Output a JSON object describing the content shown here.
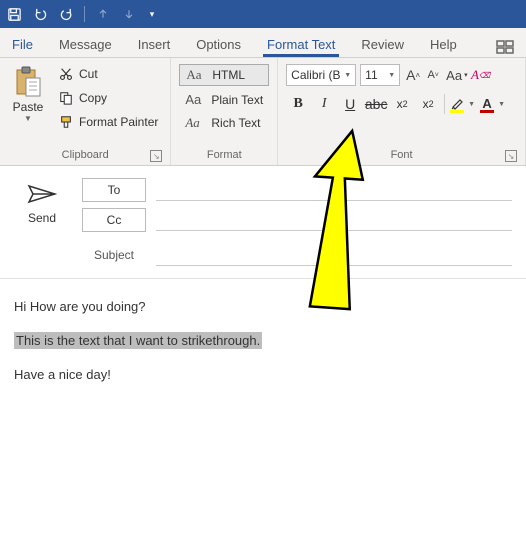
{
  "tabs": {
    "file": "File",
    "message": "Message",
    "insert": "Insert",
    "options": "Options",
    "format_text": "Format Text",
    "review": "Review",
    "help": "Help"
  },
  "clipboard": {
    "paste": "Paste",
    "cut": "Cut",
    "copy": "Copy",
    "format_painter": "Format Painter",
    "group_label": "Clipboard"
  },
  "format_group": {
    "html": "HTML",
    "plain": "Plain Text",
    "rich": "Rich Text",
    "aa": "Aa",
    "group_label": "Format"
  },
  "font": {
    "name": "Calibri (B",
    "size": "11",
    "group_label": "Font",
    "grow": "A",
    "shrink": "A",
    "case": "Aa",
    "bold": "B",
    "italic": "I",
    "underline": "U",
    "strike": "abc",
    "sub_base": "x",
    "sub_sub": "2",
    "sup_base": "x",
    "sup_sup": "2"
  },
  "compose": {
    "send": "Send",
    "to": "To",
    "cc": "Cc",
    "subject": "Subject"
  },
  "body": {
    "line1": "Hi How are you doing?",
    "line2": "This is the text that I want to strikethrough.   ",
    "line3": "Have a nice day!"
  },
  "colors": {
    "highlight": "#ffff00",
    "fontcolor": "#c00000"
  }
}
